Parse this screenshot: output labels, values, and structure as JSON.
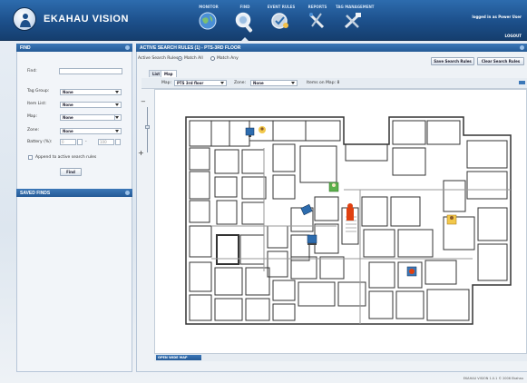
{
  "app": {
    "name": "EKAHAU VISION",
    "user_info": "logged in as Power User",
    "logout": "LOGOUT",
    "footer": "EKAHAU VISION 1.0.1   © 2006 Ekahau"
  },
  "nav": [
    {
      "label": "MONITOR",
      "icon": "globe-icon"
    },
    {
      "label": "FIND",
      "icon": "magnifier-icon",
      "active": true
    },
    {
      "label": "EVENT RULES",
      "icon": "rules-icon"
    },
    {
      "label": "REPORTS",
      "icon": "reports-icon"
    },
    {
      "label": "TAG MANAGEMENT",
      "icon": "tag-management-icon"
    }
  ],
  "find_panel": {
    "title": "FIND",
    "find_label": "Find:",
    "find_value": "",
    "tag_group_label": "Tag Group:",
    "tag_group_value": "None",
    "item_list_label": "Item List:",
    "item_list_value": "None",
    "map_label": "Map:",
    "map_value": "None",
    "zone_label": "Zone:",
    "zone_value": "None",
    "battery_label": "Battery (%):",
    "battery_min": "0",
    "battery_to": "-",
    "battery_max": "100",
    "append_label": "Append to active search rules",
    "find_button": "Find"
  },
  "saved_panel": {
    "title": "SAVED FINDS"
  },
  "main": {
    "title": "ACTIVE SEARCH RULES (1) - PTS-3RD FLOOR",
    "rules_label": "Active Search Rules:",
    "match_all": "Match All",
    "match_any": "Match Any",
    "save_button": "Save Search Rules",
    "clear_button": "Clear Search Rules",
    "tabs": [
      "List",
      "Map"
    ],
    "map_label": "Map:",
    "map_value": "PTS 3rd floor",
    "zone_label": "Zone:",
    "zone_value": "None",
    "items_on_map": "Items on Map: 8",
    "open_map_button": "OPEN WIDE MAP"
  },
  "colors": {
    "header": "#1c4f8a",
    "panel_head": "#2f68a7",
    "alert_marker": "#e04010"
  }
}
